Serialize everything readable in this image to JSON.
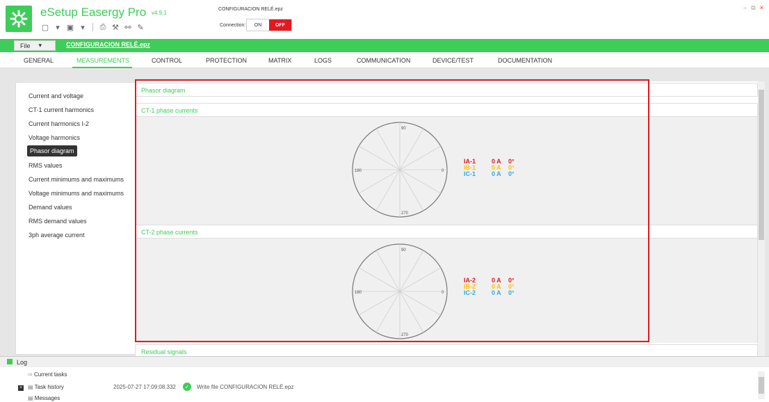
{
  "app": {
    "title": "eSetup Easergy Pro",
    "version": "v4.9.1",
    "open_file": "CONFIGURACION RELÉ.epz"
  },
  "connection": {
    "label": "Connection:",
    "on": "ON",
    "off": "OFF",
    "state": "OFF"
  },
  "window_controls": {
    "minimize": "–",
    "restore": "⧉",
    "close": "×"
  },
  "quick_toolbar": [
    "new-icon",
    "open-icon",
    "save-icon",
    "export-icon",
    "print-icon",
    "tools-icon",
    "compare-icon",
    "wrench-icon"
  ],
  "menubar": {
    "file": "File",
    "project": "CONFIGURACION RELÉ.epz"
  },
  "tabs": [
    "GENERAL",
    "MEASUREMENTS",
    "CONTROL",
    "PROTECTION",
    "MATRIX",
    "LOGS",
    "COMMUNICATION",
    "DEVICE/TEST",
    "DOCUMENTATION"
  ],
  "active_tab": "MEASUREMENTS",
  "nav": [
    "Current and voltage",
    "CT-1 current harmonics",
    "Current harmonics I-2",
    "Voltage harmonics",
    "Phasor diagram",
    "RMS values",
    "Current minimums and maximums",
    "Voltage minimums and maximums",
    "Demand values",
    "RMS demand values",
    "3ph average current"
  ],
  "active_nav": "Phasor diagram",
  "sections": {
    "phasor": "Phasor diagram",
    "ct1": "CT-1 phase currents",
    "ct2": "CT-2 phase currents",
    "residual": "Residual signals"
  },
  "angles": {
    "a90": "90",
    "a180": "180",
    "a0": "0",
    "a270": "270"
  },
  "ct1": [
    {
      "label": "IA-1",
      "value": "0 A",
      "angle": "0°",
      "color": "#e4181e"
    },
    {
      "label": "IB-1",
      "value": "0 A",
      "angle": "0°",
      "color": "#ffc000"
    },
    {
      "label": "IC-1",
      "value": "0 A",
      "angle": "0°",
      "color": "#35a9e6"
    }
  ],
  "ct2": [
    {
      "label": "IA-2",
      "value": "0 A",
      "angle": "0°",
      "color": "#e4181e"
    },
    {
      "label": "IB-2",
      "value": "0 A",
      "angle": "0°",
      "color": "#ffc000"
    },
    {
      "label": "IC-2",
      "value": "0 A",
      "angle": "0°",
      "color": "#35a9e6"
    }
  ],
  "log": {
    "title": "Log",
    "current_tasks": "Current tasks",
    "task_history": "Task history",
    "messages": "Messages",
    "timestamp": "2025-07-27 17:09:08.332",
    "message": "Write file CONFIGURACION RELÉ.epz"
  },
  "colors": {
    "brand": "#3dcd58",
    "alert": "#e4181e"
  }
}
